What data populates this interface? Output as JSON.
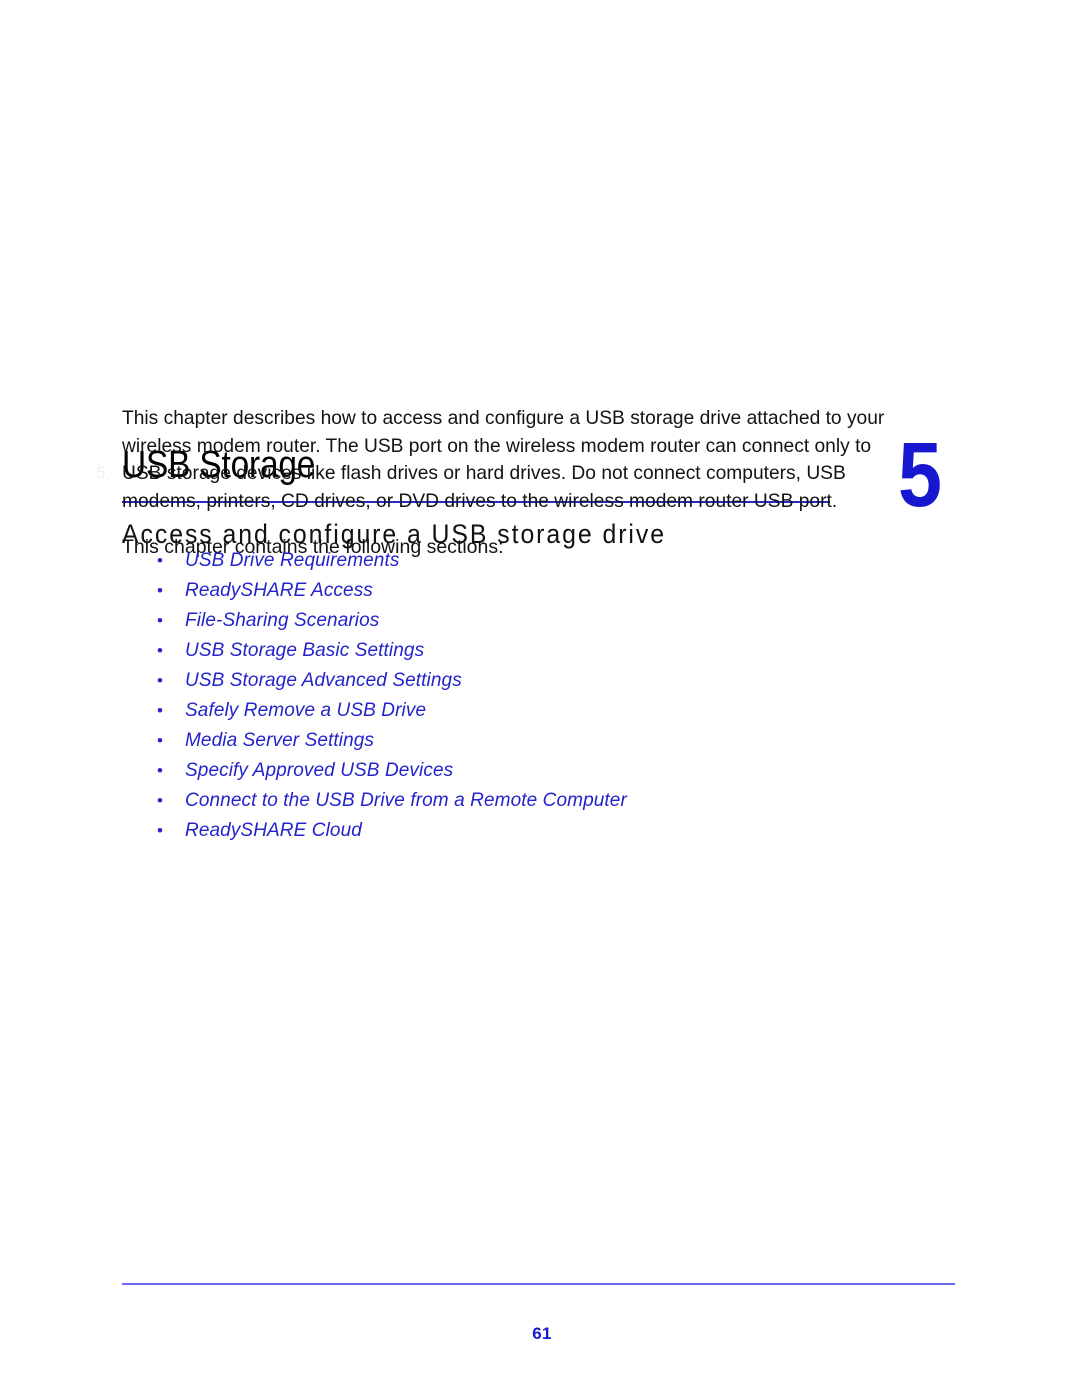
{
  "document": {
    "chapter_number": "5",
    "chapter_title": "USB Storage",
    "chapter_subtitle": "Access and configure a USB storage drive",
    "margin_mark": "5."
  },
  "body": {
    "intro_paragraph": "This chapter describes how to access and configure a USB storage drive attached to your wireless modem router. The USB port on the wireless modem router can connect only to USB storage devices like flash drives or hard drives. Do not connect computers, USB modems, printers, CD drives, or DVD drives to the wireless modem router USB port.",
    "sections_lead": "This chapter contains the following sections:"
  },
  "sections": {
    "bullet_glyph": "•",
    "items": [
      {
        "label": "USB Drive Requirements"
      },
      {
        "label": "ReadySHARE Access"
      },
      {
        "label": "File-Sharing Scenarios"
      },
      {
        "label": "USB Storage Basic Settings"
      },
      {
        "label": "USB Storage Advanced Settings"
      },
      {
        "label": "Safely Remove a USB Drive"
      },
      {
        "label": "Media Server Settings"
      },
      {
        "label": "Specify Approved USB Devices"
      },
      {
        "label": "Connect to the USB Drive from a Remote Computer"
      },
      {
        "label": "ReadySHARE Cloud"
      }
    ]
  },
  "footer": {
    "page_number": "61"
  },
  "colors": {
    "accent_blue": "#1717cf",
    "link_blue": "#2323cc",
    "rule_blue": "#2a2ac4",
    "footer_rule_blue": "#6b6bf5",
    "text_black": "#131313"
  }
}
